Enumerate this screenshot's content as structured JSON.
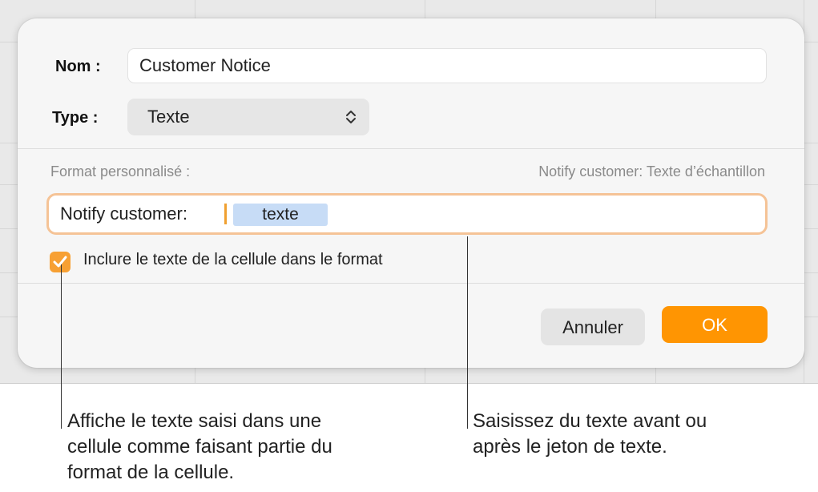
{
  "dialog": {
    "name_label": "Nom :",
    "name_value": "Customer Notice",
    "type_label": "Type :",
    "type_value": "Texte",
    "format_label": "Format personnalisé :",
    "preview": "Notify customer: Texte d’échantillon",
    "format_prefix": "Notify customer:",
    "token_label": "texte",
    "include_checkbox": {
      "label": "Inclure le texte de la cellule dans le format",
      "checked": true
    },
    "cancel_label": "Annuler",
    "ok_label": "OK"
  },
  "callouts": {
    "left": [
      "Affiche le texte saisi dans une",
      "cellule comme faisant partie du",
      "format de la cellule."
    ],
    "right": [
      "Saisissez du texte avant ou",
      "après le jeton de texte."
    ]
  },
  "colors": {
    "accent": "#ff9502",
    "token_bg": "#c7dcf6",
    "focus_ring": "#f5c396"
  },
  "icons": {
    "type_chevron": "chevron-up-down-icon",
    "checkbox": "checkmark-icon"
  }
}
